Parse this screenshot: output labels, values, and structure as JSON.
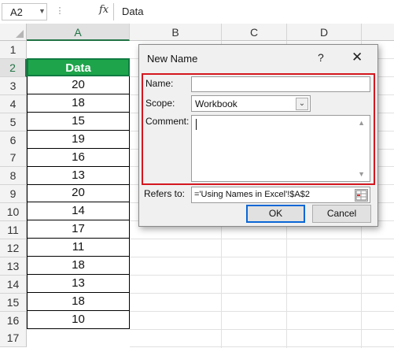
{
  "formula_bar": {
    "name_box": "A2",
    "fx_label": "fx",
    "value": "Data"
  },
  "columns": [
    "A",
    "B",
    "C",
    "D"
  ],
  "rows": [
    "1",
    "2",
    "3",
    "4",
    "5",
    "6",
    "7",
    "8",
    "9",
    "10",
    "11",
    "12",
    "13",
    "14",
    "15",
    "16",
    "17"
  ],
  "column_a": {
    "header": "Data",
    "values": [
      "20",
      "18",
      "15",
      "19",
      "16",
      "13",
      "20",
      "14",
      "17",
      "11",
      "18",
      "13",
      "18",
      "10"
    ]
  },
  "dialog": {
    "title": "New Name",
    "help": "?",
    "close": "✕",
    "name_label": "Name:",
    "name_value": "",
    "scope_label": "Scope:",
    "scope_value": "Workbook",
    "comment_label": "Comment:",
    "comment_value": "",
    "refers_label": "Refers to:",
    "refers_value": "='Using Names in Excel'!$A$2",
    "ok_label": "OK",
    "cancel_label": "Cancel"
  },
  "colors": {
    "header_fill": "#1ea54b",
    "highlight_border": "#d4171f",
    "selection_accent": "#217346"
  }
}
